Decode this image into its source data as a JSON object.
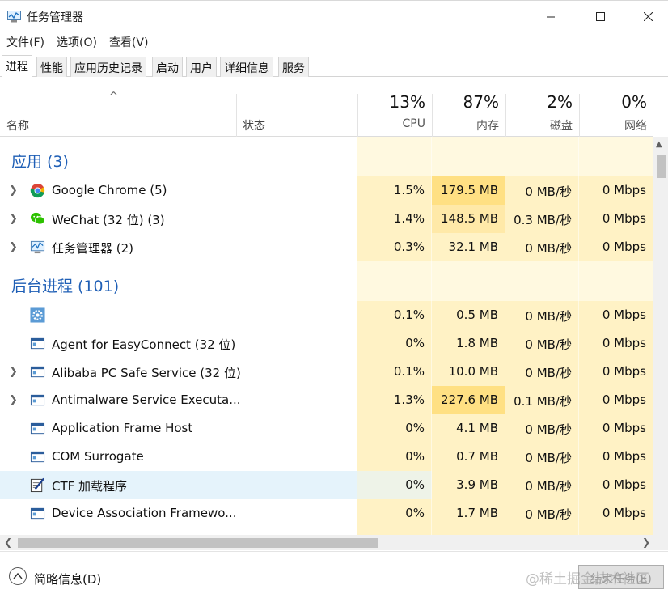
{
  "window": {
    "title": "任务管理器"
  },
  "menu": [
    "文件(F)",
    "选项(O)",
    "查看(V)"
  ],
  "tabs": [
    "进程",
    "性能",
    "应用历史记录",
    "启动",
    "用户",
    "详细信息",
    "服务"
  ],
  "columns": {
    "name": "名称",
    "status": "状态",
    "cpu": {
      "pct": "13%",
      "label": "CPU"
    },
    "memory": {
      "pct": "87%",
      "label": "内存"
    },
    "disk": {
      "pct": "2%",
      "label": "磁盘"
    },
    "network": {
      "pct": "0%",
      "label": "网络"
    }
  },
  "groups": {
    "apps": "应用 (3)",
    "background": "后台进程 (101)"
  },
  "rows": [
    {
      "name": "Google Chrome (5)",
      "icon": "chrome-icon",
      "expandable": true,
      "cpu": "1.5%",
      "mem": "179.5 MB",
      "disk": "0 MB/秒",
      "net": "0 Mbps"
    },
    {
      "name": "WeChat (32 位) (3)",
      "icon": "wechat-icon",
      "expandable": true,
      "cpu": "1.4%",
      "mem": "148.5 MB",
      "disk": "0.3 MB/秒",
      "net": "0 Mbps"
    },
    {
      "name": "任务管理器 (2)",
      "icon": "task-manager-icon",
      "expandable": true,
      "cpu": "0.3%",
      "mem": "32.1 MB",
      "disk": "0 MB/秒",
      "net": "0 Mbps"
    },
    {
      "name": "",
      "icon": "gear-icon",
      "expandable": false,
      "cpu": "0.1%",
      "mem": "0.5 MB",
      "disk": "0 MB/秒",
      "net": "0 Mbps"
    },
    {
      "name": "Agent for EasyConnect (32 位)",
      "icon": "window-icon",
      "expandable": false,
      "cpu": "0%",
      "mem": "1.8 MB",
      "disk": "0 MB/秒",
      "net": "0 Mbps"
    },
    {
      "name": "Alibaba PC Safe Service (32 位)",
      "icon": "window-icon",
      "expandable": true,
      "cpu": "0.1%",
      "mem": "10.0 MB",
      "disk": "0 MB/秒",
      "net": "0 Mbps"
    },
    {
      "name": "Antimalware Service Executa...",
      "icon": "window-icon",
      "expandable": true,
      "cpu": "1.3%",
      "mem": "227.6 MB",
      "disk": "0.1 MB/秒",
      "net": "0 Mbps"
    },
    {
      "name": "Application Frame Host",
      "icon": "window-icon",
      "expandable": false,
      "cpu": "0%",
      "mem": "4.1 MB",
      "disk": "0 MB/秒",
      "net": "0 Mbps"
    },
    {
      "name": "COM Surrogate",
      "icon": "window-icon",
      "expandable": false,
      "cpu": "0%",
      "mem": "0.7 MB",
      "disk": "0 MB/秒",
      "net": "0 Mbps"
    },
    {
      "name": "CTF 加载程序",
      "icon": "pen-notepad-icon",
      "expandable": false,
      "cpu": "0%",
      "mem": "3.9 MB",
      "disk": "0 MB/秒",
      "net": "0 Mbps"
    },
    {
      "name": "Device Association Framewo...",
      "icon": "window-icon",
      "expandable": false,
      "cpu": "0%",
      "mem": "1.7 MB",
      "disk": "0 MB/秒",
      "net": "0 Mbps"
    }
  ],
  "footer": {
    "fewer_details": "简略信息(D)",
    "end_task": "结束任务(E)",
    "watermark": "@稀土掘金技术社区"
  },
  "colors": {
    "heat_pale": "#fff9e0",
    "heat_yellow": "#fff2c5",
    "heat_mid": "#ffe9a8",
    "heat_strong": "#ffe083",
    "group_title": "#1f5fb6",
    "selection": "#e5f3fb"
  }
}
